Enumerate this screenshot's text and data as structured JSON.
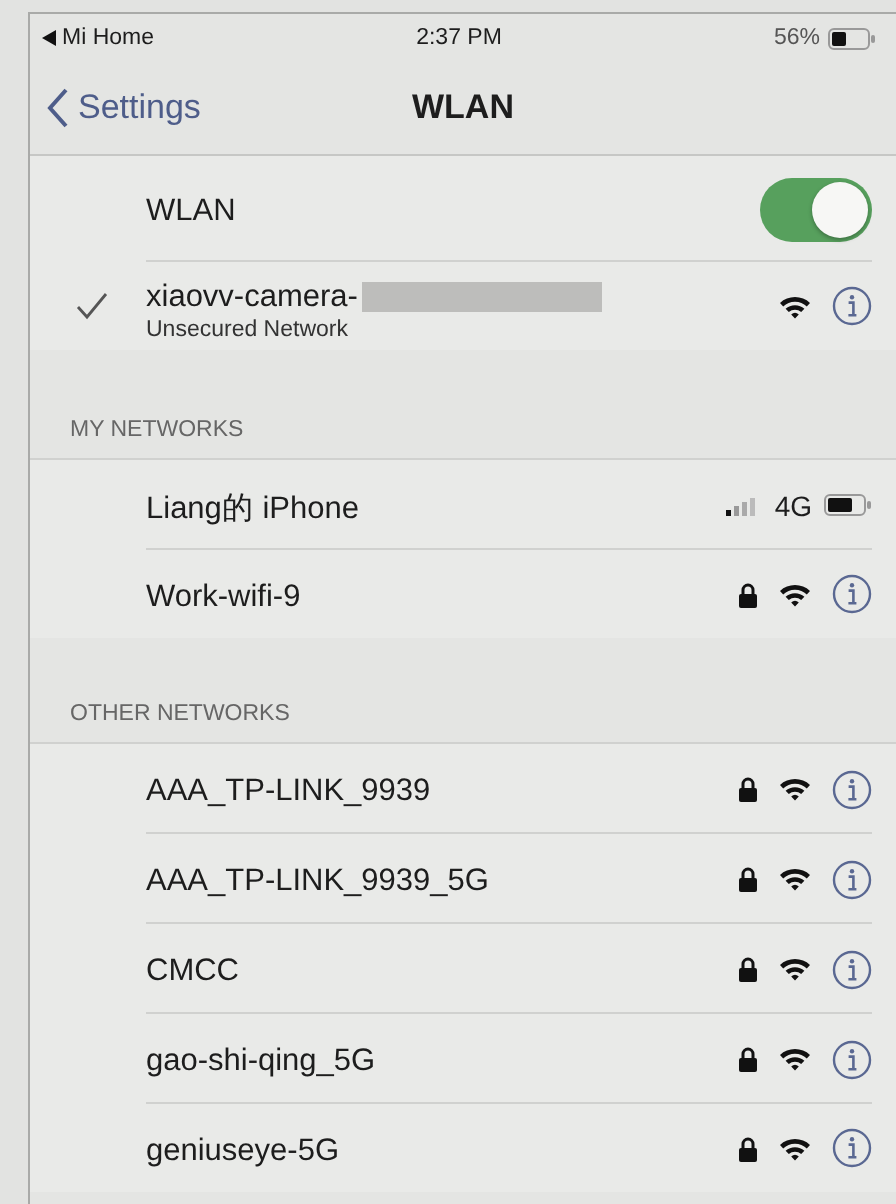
{
  "status_bar": {
    "back_app": "Mi Home",
    "time": "2:37 PM",
    "battery": "56%"
  },
  "nav": {
    "back": "Settings",
    "title": "WLAN"
  },
  "wlan": {
    "label": "WLAN",
    "on": true
  },
  "current": {
    "name": "xiaovv-camera-",
    "subtitle": "Unsecured Network",
    "connected": true,
    "redacted": true,
    "locked": false
  },
  "my_networks": {
    "header": "MY NETWORKS",
    "items": [
      {
        "kind": "hotspot",
        "name": "Liang的 iPhone",
        "network": "4G"
      },
      {
        "kind": "wifi",
        "name": "Work-wifi-9",
        "locked": true
      }
    ]
  },
  "other_networks": {
    "header": "OTHER NETWORKS",
    "items": [
      {
        "kind": "wifi",
        "name": "AAA_TP-LINK_9939",
        "locked": true
      },
      {
        "kind": "wifi",
        "name": "AAA_TP-LINK_9939_5G",
        "locked": true
      },
      {
        "kind": "wifi",
        "name": "CMCC",
        "locked": true
      },
      {
        "kind": "wifi",
        "name": "gao-shi-qing_5G",
        "locked": true
      },
      {
        "kind": "wifi",
        "name": "geniuseye-5G",
        "locked": true
      }
    ]
  }
}
